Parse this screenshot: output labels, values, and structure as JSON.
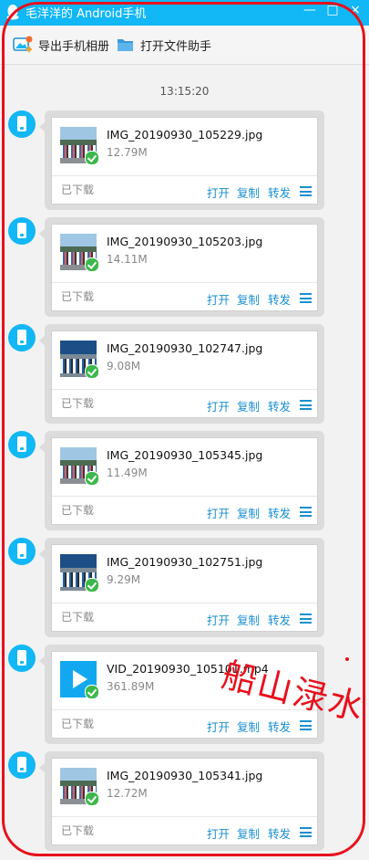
{
  "window": {
    "title": "毛洋洋的 Android手机",
    "controls": [
      "—",
      "□",
      "×"
    ]
  },
  "toolbar": {
    "export_album": "导出手机相册",
    "open_file_assistant": "打开文件助手"
  },
  "chat": {
    "timestamp": "13:15:20",
    "messages": [
      {
        "name": "IMG_20190930_105229.jpg",
        "size": "12.79M",
        "status": "已下载",
        "thumb": "img"
      },
      {
        "name": "IMG_20190930_105203.jpg",
        "size": "14.11M",
        "status": "已下载",
        "thumb": "img"
      },
      {
        "name": "IMG_20190930_102747.jpg",
        "size": "9.08M",
        "status": "已下载",
        "thumb": "img2"
      },
      {
        "name": "IMG_20190930_105345.jpg",
        "size": "11.49M",
        "status": "已下载",
        "thumb": "img"
      },
      {
        "name": "IMG_20190930_102751.jpg",
        "size": "9.29M",
        "status": "已下载",
        "thumb": "img2"
      },
      {
        "name": "VID_20190930_105101.mp4",
        "size": "361.89M",
        "status": "已下载",
        "thumb": "vid"
      },
      {
        "name": "IMG_20190930_105341.jpg",
        "size": "12.72M",
        "status": "已下载",
        "thumb": "img"
      }
    ],
    "actions": {
      "open": "打开",
      "copy": "复制",
      "forward": "转发"
    }
  },
  "watermark": "船山渌水",
  "colors": {
    "accent": "#12b7f5",
    "link": "#1a8fd1",
    "check": "#3cb84a",
    "annotation": "#e8101c"
  }
}
